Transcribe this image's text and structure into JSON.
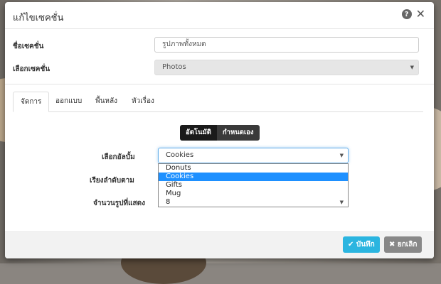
{
  "header": {
    "title": "แก้ไขเซคชั่น"
  },
  "form": {
    "section_name_label": "ชื่อเซคชั่น",
    "section_name_value": "รูปภาพทั้งหมด",
    "section_select_label": "เลือกเซคชั่น",
    "section_select_value": "Photos"
  },
  "tabs": [
    "จัดการ",
    "ออกแบบ",
    "พื้นหลัง",
    "หัวเรื่อง"
  ],
  "mode_toggle": {
    "auto": "อัตโนมัติ",
    "custom": "กำหนดเอง"
  },
  "album": {
    "label": "เลือกอัลบั้ม",
    "selected": "Cookies",
    "options": [
      "Donuts",
      "Cookies",
      "Gifts",
      "Mug",
      "8"
    ]
  },
  "sort_label": "เรียงลำดับตาม",
  "count_label": "จำนวนรูปที่แสดง",
  "footer": {
    "save": "บันทึก",
    "cancel": "ยกเลิก"
  }
}
